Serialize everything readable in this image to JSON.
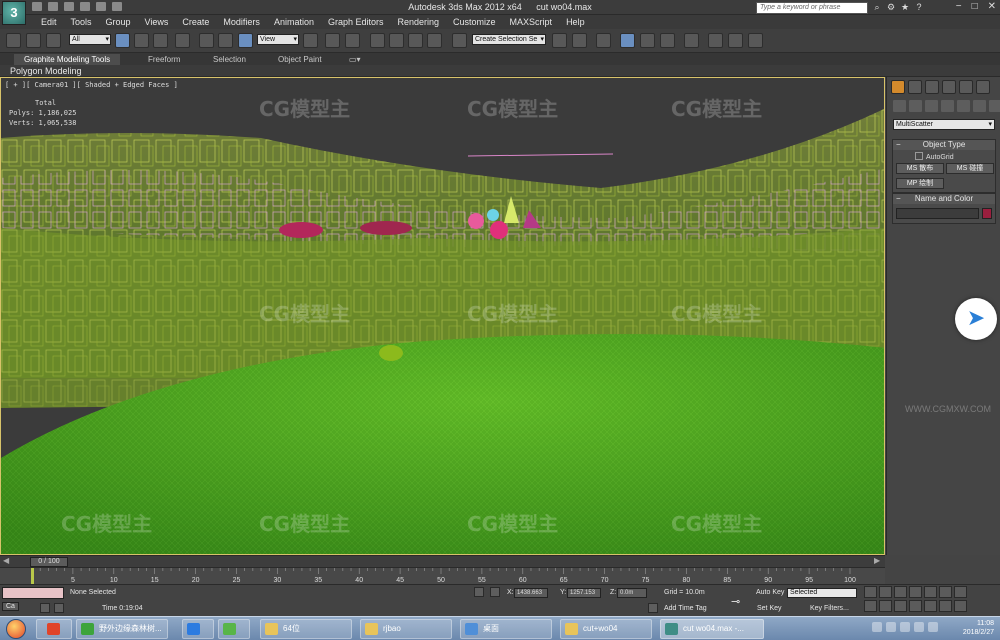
{
  "titlebar": {
    "app_title": "Autodesk 3ds Max  2012 x64",
    "file_name": "cut wo04.max",
    "search_placeholder": "Type a keyword or phrase",
    "logo_text": "3"
  },
  "menu": [
    "Edit",
    "Tools",
    "Group",
    "Views",
    "Create",
    "Modifiers",
    "Animation",
    "Graph Editors",
    "Rendering",
    "Customize",
    "MAXScript",
    "Help"
  ],
  "toolbar": {
    "selection_filter": "All",
    "reference_coord": "View",
    "named_selection": "Create Selection Se"
  },
  "ribbon": {
    "tabs": [
      "Graphite Modeling Tools",
      "Freeform",
      "Selection",
      "Object Paint"
    ],
    "active_tab": "Graphite Modeling Tools",
    "sub_label": "Polygon Modeling"
  },
  "viewport": {
    "label": "[ + ][ Camera01 ][ Shaded + Edged Faces ]",
    "stats_title": "Total",
    "polys_label": "Polys:",
    "polys_value": "1,186,025",
    "verts_label": "Verts:",
    "verts_value": "1,065,538",
    "watermark": "CG模型主"
  },
  "command_panel": {
    "object_category": "MultiScatter",
    "object_type_title": "Object Type",
    "autogrid_label": "AutoGrid",
    "buttons": [
      "MS 散布",
      "MS 碰撞",
      "MP 绘制"
    ],
    "name_color_title": "Name and Color",
    "color_swatch": "#9a1f3e",
    "url_watermark": "WWW.CGMXW.COM"
  },
  "timeline": {
    "frame_display": "0 / 100",
    "ticks": [
      "5",
      "10",
      "15",
      "20",
      "25",
      "30",
      "35",
      "40",
      "45",
      "50",
      "55",
      "60",
      "65",
      "70",
      "75",
      "80",
      "85",
      "90",
      "95",
      "100"
    ]
  },
  "status": {
    "selection_msg": "None Selected",
    "time_msg": "Time  0:19:04",
    "x_label": "X:",
    "x_value": "1438.663",
    "y_label": "Y:",
    "y_value": "1257.153",
    "z_label": "Z:",
    "z_value": "0.0m",
    "grid": "Grid = 10.0m",
    "add_time_tag": "Add Time Tag",
    "auto_key": "Auto Key",
    "set_key": "Set Key",
    "key_mode": "Selected",
    "key_filters": "Key Filters..."
  },
  "taskbar": {
    "tasks": [
      {
        "label": "野外边缘森林树...",
        "color": "#3da43b"
      },
      {
        "label": "",
        "color": "#2c7be0"
      },
      {
        "label": "",
        "color": "#58b548"
      },
      {
        "label": "64位",
        "color": "#e8c45a"
      },
      {
        "label": "rjbao",
        "color": "#e8c45a"
      },
      {
        "label": "桌面",
        "color": "#4f8fd8"
      },
      {
        "label": "cut+wo04",
        "color": "#e8c45a"
      },
      {
        "label": "cut wo04.max -...",
        "color": "#3f8d86"
      }
    ],
    "left_task": "Ca",
    "time": "11:08",
    "date": "2018/2/27"
  },
  "colors": {
    "grass": "#3f8f1c",
    "foliage": "#a3b83a",
    "pink_bounds": "#d9a3d4",
    "viewport_border": "#d8c36a"
  }
}
